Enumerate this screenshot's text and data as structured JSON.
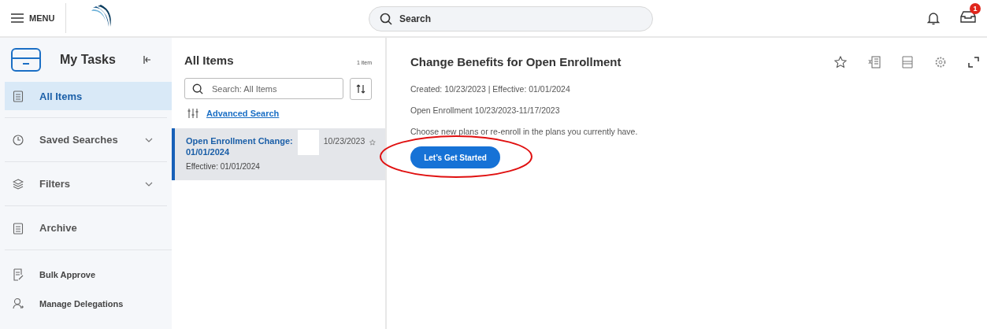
{
  "header": {
    "menu_label": "MENU",
    "search": {
      "placeholder": "Search"
    },
    "inbox_badge": "1"
  },
  "sidebar": {
    "title": "My Tasks",
    "items": [
      {
        "label": "All Items",
        "kind": "section",
        "selected": true
      },
      {
        "label": "Saved Searches",
        "kind": "section",
        "selected": false,
        "expanded": false
      },
      {
        "label": "Filters",
        "kind": "section",
        "selected": false,
        "expanded": false
      },
      {
        "label": "Archive",
        "kind": "section",
        "selected": false
      },
      {
        "label": "Bulk Approve",
        "kind": "action",
        "selected": false
      },
      {
        "label": "Manage Delegations",
        "kind": "action",
        "selected": false
      }
    ]
  },
  "list": {
    "title": "All Items",
    "count": "1 item",
    "search": {
      "placeholder": "Search: All Items"
    },
    "advanced_search": "Advanced Search",
    "items": [
      {
        "title_line1": "Open Enrollment Change:",
        "title_line2": "01/01/2024",
        "date": "10/23/2023",
        "subtitle": "Effective: 01/01/2024",
        "selected": true,
        "redacted": true
      }
    ]
  },
  "detail": {
    "title": "Change Benefits for Open Enrollment",
    "lines": [
      "Created: 10/23/2023 | Effective: 01/01/2024",
      "Open Enrollment 10/23/2023-11/17/2023",
      "Choose new plans or re-enroll in the plans you currently have."
    ],
    "button": "Let’s Get Started",
    "highlighted": true
  }
}
